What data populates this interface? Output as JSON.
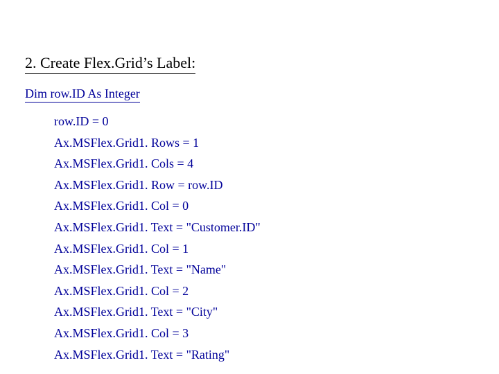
{
  "heading": "2. Create Flex.Grid’s Label:",
  "declaration": "Dim row.ID As Integer",
  "lines": [
    "row.ID = 0",
    "Ax.MSFlex.Grid1. Rows = 1",
    "Ax.MSFlex.Grid1. Cols = 4",
    "Ax.MSFlex.Grid1. Row = row.ID",
    "Ax.MSFlex.Grid1. Col = 0",
    "Ax.MSFlex.Grid1. Text = \"Customer.ID\"",
    "Ax.MSFlex.Grid1. Col = 1",
    "Ax.MSFlex.Grid1. Text = \"Name\"",
    "Ax.MSFlex.Grid1. Col = 2",
    "Ax.MSFlex.Grid1. Text = \"City\"",
    "Ax.MSFlex.Grid1. Col = 3",
    "Ax.MSFlex.Grid1. Text = \"Rating\""
  ]
}
